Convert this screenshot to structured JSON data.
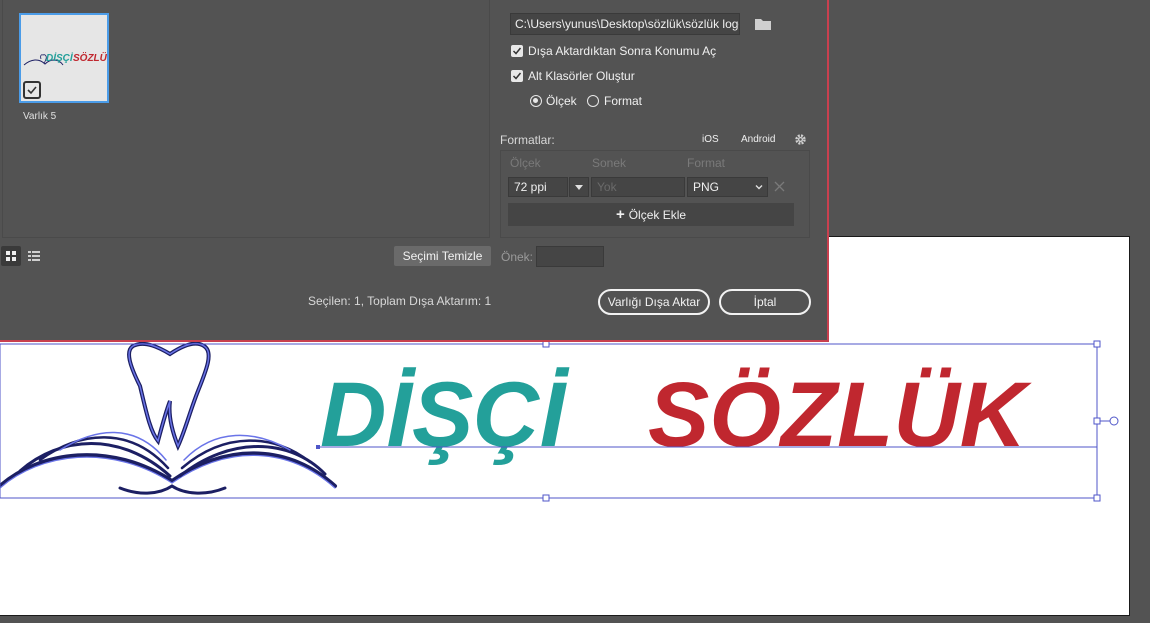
{
  "dialog": {
    "asset_label": "Varlık 5",
    "thumb_logo_left": "DİŞÇİ",
    "thumb_logo_right": "SÖZLÜK",
    "path_value": "C:\\Users\\yunus\\Desktop\\sözlük\\sözlük logo",
    "open_location_label": "Dışa Aktardıktan Sonra Konumu Aç",
    "create_subfolders_label": "Alt Klasörler Oluştur",
    "radio_scale_label": "Ölçek",
    "radio_format_label": "Format",
    "formats_label": "Formatlar:",
    "ios_label": "iOS",
    "android_label": "Android",
    "col_scale": "Ölçek",
    "col_suffix": "Sonek",
    "col_format": "Format",
    "scale_value": "72 ppi",
    "suffix_placeholder": "Yok",
    "format_value": "PNG",
    "add_scale_label": "Ölçek Ekle",
    "clear_selection_label": "Seçimi Temizle",
    "prefix_label": "Önek:",
    "status_text": "Seçilen: 1, Toplam Dışa Aktarım: 1",
    "export_button_label": "Varlığı Dışa Aktar",
    "cancel_button_label": "İptal"
  },
  "artwork": {
    "logo_left": "DİŞÇİ",
    "logo_right": "SÖZLÜK",
    "colors": {
      "left_text": "#23a09a",
      "right_text": "#c0272f",
      "tooth_outline": "#1c1f63",
      "selection": "#4f56c8"
    }
  },
  "colors": {
    "dialog_bg": "#535353",
    "dialog_border": "#c9404f",
    "thumb_highlight": "#4b9ce8"
  }
}
